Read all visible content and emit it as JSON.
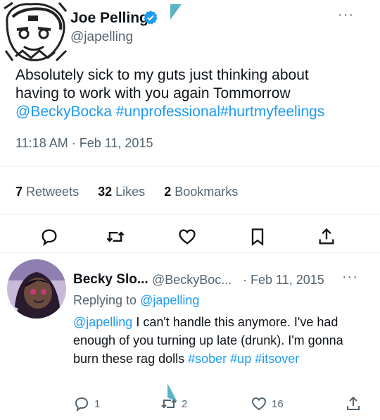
{
  "main_tweet": {
    "display_name": "Joe Pelling",
    "handle": "@japelling",
    "text_line1": "Absolutely sick to my guts just thinking about",
    "text_line2": "having to work with you again Tommorrow",
    "mention": "@BeckyBocka",
    "hashtags": "#unprofessional#hurtmyfeelings",
    "timestamp": "11:18 AM · Feb 11, 2015",
    "stats": {
      "retweets_count": "7",
      "retweets_label": "Retweets",
      "likes_count": "32",
      "likes_label": "Likes",
      "bookmarks_count": "2",
      "bookmarks_label": "Bookmarks"
    },
    "more": "···",
    "icons": [
      "avatar-sketch",
      "verified-badge-icon",
      "reply-icon",
      "retweet-icon",
      "like-icon",
      "bookmark-icon",
      "share-icon",
      "more-icon"
    ]
  },
  "reply_tweet": {
    "display_name": "Becky Slo...",
    "handle": "@BeckyBoc...",
    "dot": "·",
    "date": "Feb 11, 2015",
    "replying_prefix": "Replying to",
    "replying_handle": "@japelling",
    "mention": "@japelling",
    "text_part1": " I can't handle this anymore. I've had enough of you turning up late (drunk). I'm gonna burn these rag dolls ",
    "hashtag_sober": "#sober",
    "hashtag_up": "#up",
    "hashtag_itsover": "#itsover",
    "more": "···",
    "reply_count": "1",
    "retweet_count": "2",
    "like_count": "16"
  },
  "colors": {
    "link": "#1d9bf0",
    "secondary": "#536471",
    "text": "#0f1419",
    "verified": "#1d9bf0",
    "divider": "#eff3f4",
    "deco": "#5ab3c2"
  }
}
